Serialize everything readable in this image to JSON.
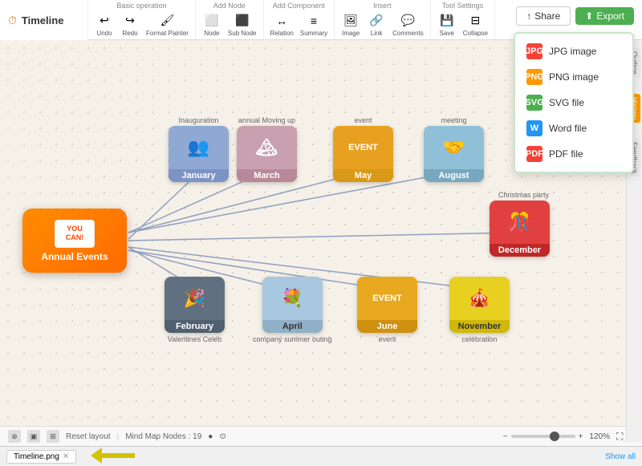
{
  "app": {
    "title": "Timeline"
  },
  "toolbar": {
    "sections": [
      {
        "label": "Basic operation",
        "items": [
          "Undo",
          "Redo",
          "Format Painter"
        ]
      },
      {
        "label": "Add Node",
        "items": [
          "Node",
          "Sub Node"
        ]
      },
      {
        "label": "Add Component",
        "items": [
          "Relation",
          "Summary"
        ]
      },
      {
        "label": "Insert",
        "items": [
          "Image",
          "Link",
          "Comments"
        ]
      },
      {
        "label": "Tool Settings",
        "items": [
          "Save",
          "Collapse"
        ]
      }
    ],
    "share_label": "Share",
    "export_label": "Export"
  },
  "export_menu": {
    "items": [
      {
        "label": "JPG image",
        "color": "#f44336",
        "icon": "JPG"
      },
      {
        "label": "PNG image",
        "color": "#ff9800",
        "icon": "PNG"
      },
      {
        "label": "SVG file",
        "color": "#4caf50",
        "icon": "SVG"
      },
      {
        "label": "Word file",
        "color": "#2196f3",
        "icon": "W"
      },
      {
        "label": "PDF file",
        "color": "#f44336",
        "icon": "PDF"
      }
    ]
  },
  "right_panel": {
    "items": [
      "Outline",
      "History",
      "Feedback"
    ]
  },
  "central_node": {
    "sticker": "YOU\nCAN!",
    "text": "Annual Events"
  },
  "months": [
    {
      "name": "January",
      "color": "#7c94c4",
      "bg": "#8fa8d4",
      "emoji": "👥",
      "caption": "Inauguration",
      "caption_pos": "top"
    },
    {
      "name": "March",
      "color": "#d4a0b0",
      "bg": "#c8a0b0",
      "emoji": "🏔",
      "caption": "annual Moving up",
      "caption_pos": "top"
    },
    {
      "name": "May",
      "color": "#e8b040",
      "bg": "#f0b830",
      "emoji": "EVENT",
      "caption": "event",
      "caption_pos": "top"
    },
    {
      "name": "August",
      "color": "#80b0d0",
      "bg": "#90c0d8",
      "emoji": "🤝",
      "caption": "meeting",
      "caption_pos": "top"
    },
    {
      "name": "December",
      "color": "#e04040",
      "bg": "#d03030",
      "emoji": "🎊",
      "caption": "Christmas party",
      "caption_pos": "top"
    },
    {
      "name": "February",
      "color": "#708090",
      "bg": "#607080",
      "emoji": "🎉",
      "caption": "Valentines Celeb",
      "caption_pos": "bottom"
    },
    {
      "name": "April",
      "color": "#b0d0e8",
      "bg": "#a8c8e0",
      "emoji": "💐",
      "caption": "company summer outing",
      "caption_pos": "bottom"
    },
    {
      "name": "June",
      "color": "#e8a020",
      "bg": "#e8a820",
      "emoji": "EVENT",
      "caption": "event",
      "caption_pos": "bottom"
    },
    {
      "name": "November",
      "color": "#e8c820",
      "bg": "#e8d020",
      "emoji": "🎪",
      "caption": "celebration",
      "caption_pos": "bottom"
    }
  ],
  "statusbar": {
    "reset_layout": "Reset layout",
    "mind_map_nodes": "Mind Map Nodes : 19",
    "zoom_level": "120%"
  },
  "filebar": {
    "filename": "Timeline.png",
    "show_all": "Show all"
  }
}
